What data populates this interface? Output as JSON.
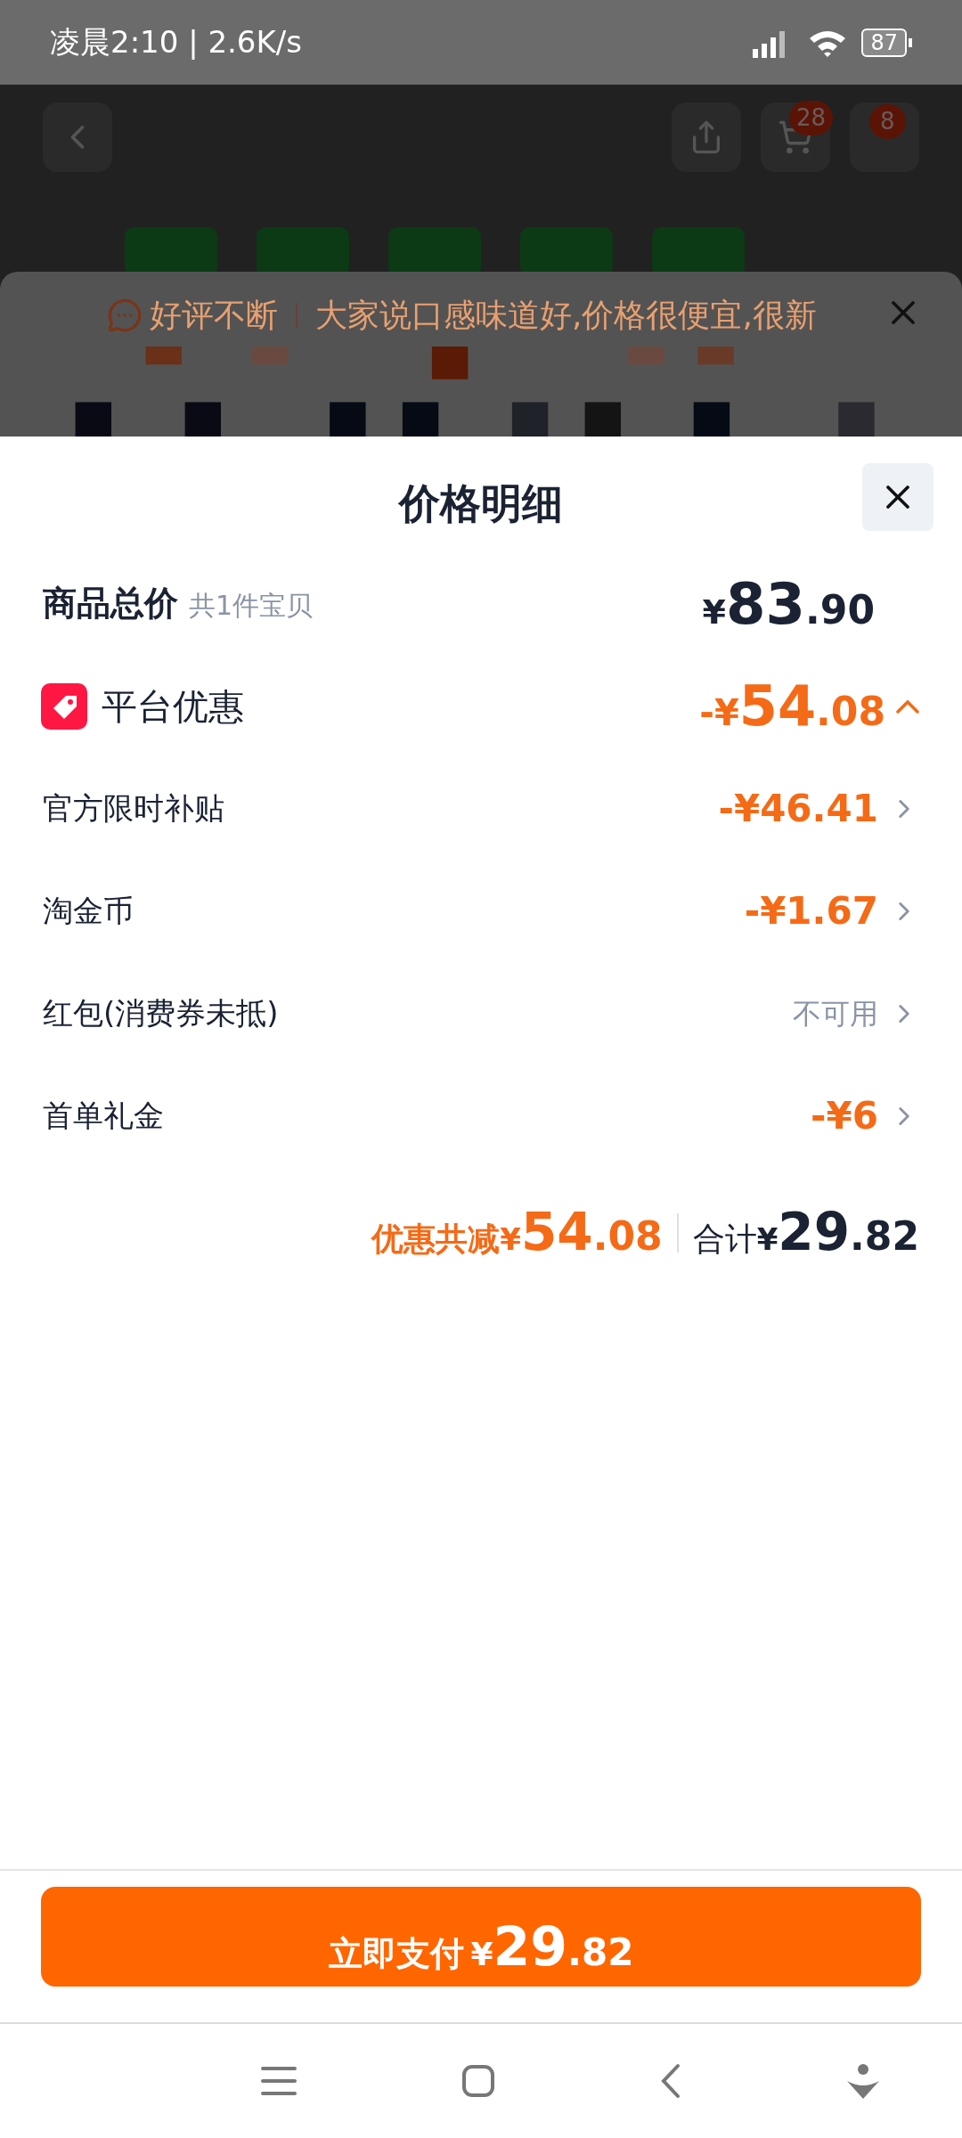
{
  "status_bar": {
    "time": "凌晨2:10 | 2.6K/s",
    "battery": "87"
  },
  "background_page": {
    "cart_badge": "28",
    "more_badge": "8",
    "review_tag": "好评不断",
    "review_text": "大家说口感味道好,价格很便宜,很新"
  },
  "sheet": {
    "title": "价格明细",
    "total": {
      "label": "商品总价",
      "note": "共1件宝贝",
      "amount": "¥83.90"
    },
    "discount": {
      "label": "平台优惠",
      "amount": "-¥54.08",
      "expanded": true
    },
    "items": [
      {
        "kind": "amount",
        "label": "官方限时补贴",
        "value": "-¥46.41"
      },
      {
        "kind": "amount",
        "label": "淘金币",
        "value": "-¥1.67"
      },
      {
        "kind": "status",
        "label": "红包(消费券未抵)",
        "value": "不可用"
      },
      {
        "kind": "amount",
        "label": "首单礼金",
        "value": "-¥6"
      }
    ],
    "summary": {
      "saved_label": "优惠共减",
      "saved": "¥54.08",
      "total_label": "合计",
      "total": "¥29.82"
    }
  },
  "pay_button": {
    "label": "立即支付",
    "amount": "¥29.82"
  }
}
